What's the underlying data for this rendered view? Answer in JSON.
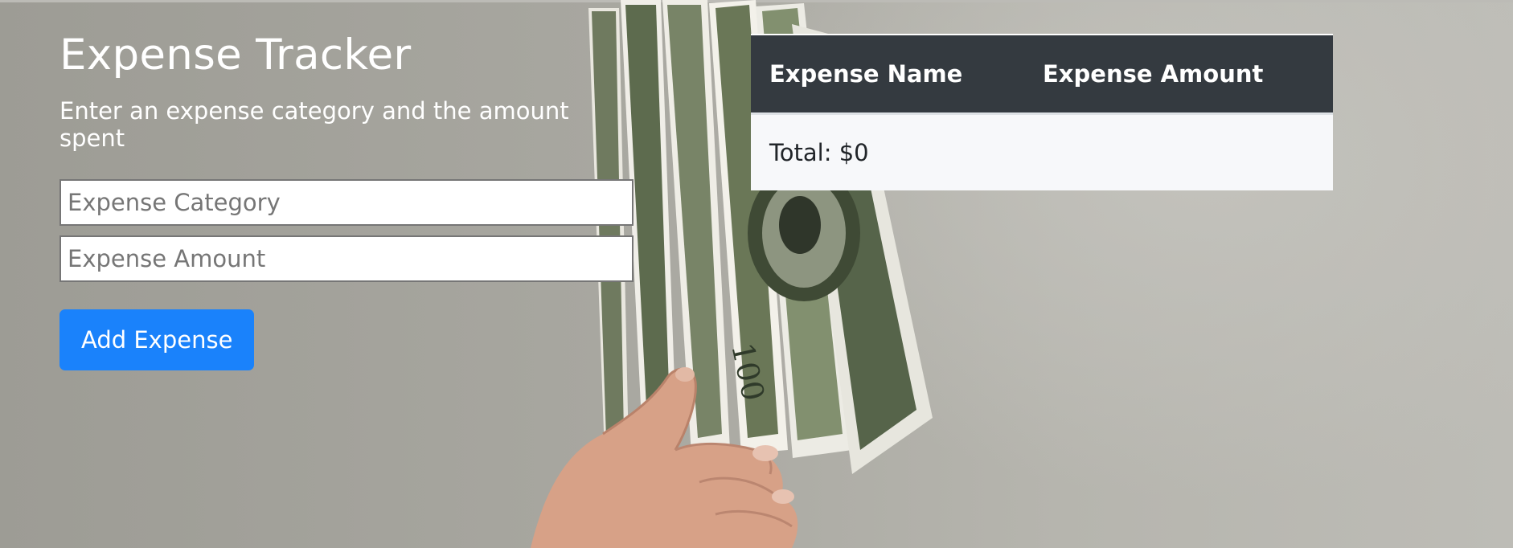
{
  "app": {
    "title": "Expense Tracker",
    "subtitle": "Enter an expense category and the amount spent"
  },
  "form": {
    "category_placeholder": "Expense Category",
    "category_value": "",
    "amount_placeholder": "Expense Amount",
    "amount_value": "",
    "add_label": "Add Expense"
  },
  "table": {
    "headers": [
      "Expense Name",
      "Expense Amount"
    ],
    "total_label": "Total: $0"
  },
  "colors": {
    "accent": "#1a82fb",
    "table_header": "#343a40",
    "table_body": "#f7f8fa"
  },
  "background": {
    "image": "hand-holding-dollar-bills"
  }
}
